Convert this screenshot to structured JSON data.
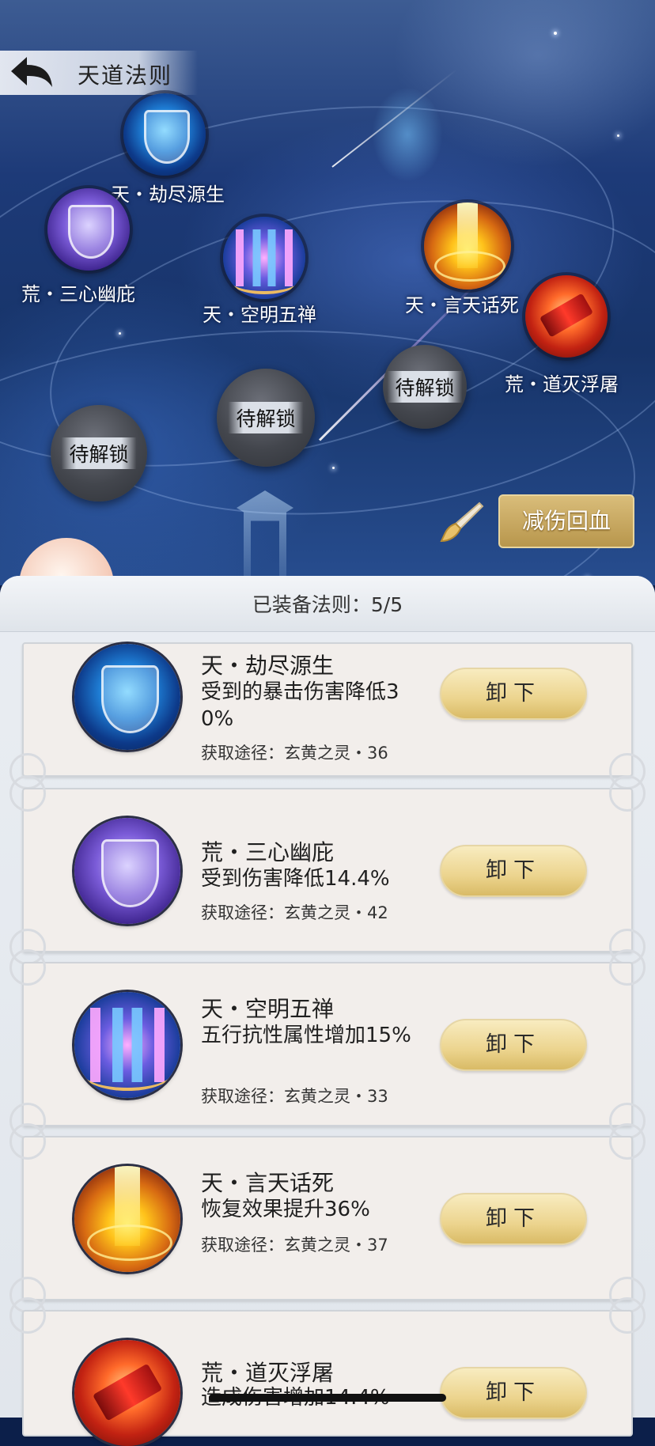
{
  "header": {
    "title": "天道法则"
  },
  "map_nodes": [
    {
      "label": "天・劫尽源生",
      "art": "blue"
    },
    {
      "label": "荒・三心幽庇",
      "art": "purple"
    },
    {
      "label": "天・空明五禅",
      "art": "cyan"
    },
    {
      "label": "天・言天话死",
      "art": "gold"
    },
    {
      "label": "荒・道灭浮屠",
      "art": "red"
    }
  ],
  "locked_nodes": [
    {
      "label": "待解锁"
    },
    {
      "label": "待解锁"
    },
    {
      "label": "待解锁"
    }
  ],
  "effect_button": {
    "label": "减伤回血"
  },
  "brush_icon": "brush-icon",
  "panel": {
    "equipped_text": "已装备法则：5/5"
  },
  "laws": [
    {
      "title": "天・劫尽源生",
      "desc": "受到的暴击伤害降低30%",
      "source": "获取途径：玄黄之灵・36",
      "button": "卸下",
      "art": "blue"
    },
    {
      "title": "荒・三心幽庇",
      "desc": "受到伤害降低14.4%",
      "source": "获取途径：玄黄之灵・42",
      "button": "卸下",
      "art": "purple"
    },
    {
      "title": "天・空明五禅",
      "desc": "五行抗性属性增加15%",
      "source": "获取途径：玄黄之灵・33",
      "button": "卸下",
      "art": "cyan"
    },
    {
      "title": "天・言天话死",
      "desc": "恢复效果提升36%",
      "source": "获取途径：玄黄之灵・37",
      "button": "卸下",
      "art": "gold"
    },
    {
      "title": "荒・道灭浮屠",
      "desc": "造成伤害增加14.4%",
      "source": "",
      "button": "卸下",
      "art": "red"
    }
  ]
}
